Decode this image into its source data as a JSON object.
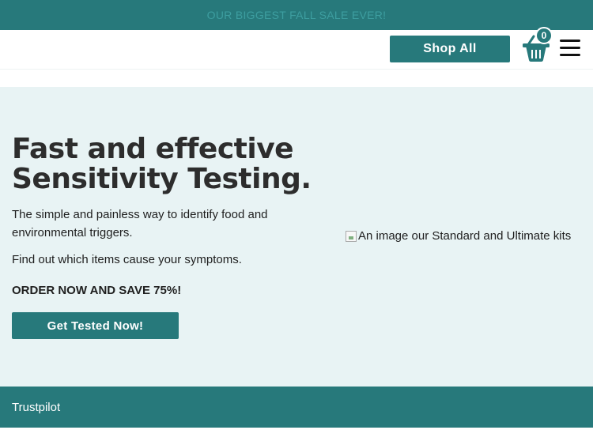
{
  "promo_bar": {
    "text": "OUR BIGGEST FALL SALE EVER!"
  },
  "header": {
    "shop_all_label": "Shop All",
    "cart_count": "0",
    "cart_icon": "basket-icon",
    "menu_icon": "hamburger-menu-icon"
  },
  "hero": {
    "title_line1": "Fast and effective",
    "title_line2": "Sensitivity Testing.",
    "description": "The simple and painless way to identify food and environmental triggers.",
    "find_out": "Find out which items cause your symptoms.",
    "promo": "ORDER NOW AND SAVE 75%!",
    "cta_label": "Get Tested Now!",
    "image_alt": "An image our Standard and Ultimate kits"
  },
  "trust_bar": {
    "text": "Trustpilot"
  },
  "colors": {
    "brand_teal": "#27797b",
    "hero_bg": "#e8f3f4",
    "promo_text": "#3d9ea0"
  }
}
